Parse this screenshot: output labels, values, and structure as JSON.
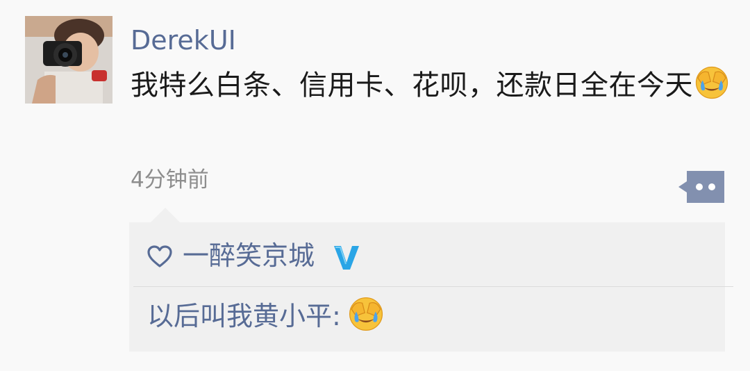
{
  "post": {
    "username": "DerekUI",
    "text": "我特么白条、信用卡、花呗，还款日全在今天",
    "emoji": "facepalm-laughing-emoji",
    "timestamp": "4分钟前"
  },
  "likes": {
    "names": "一醉笑京城",
    "icon": "heart-outline-icon",
    "badge_icon": "verified-v-icon"
  },
  "comment": {
    "author": "以后叫我黄小平",
    "separator": ":",
    "emoji": "facepalm-laughing-emoji"
  },
  "colors": {
    "link": "#576b95",
    "text": "#1a1a1a",
    "muted": "#8d8d8d",
    "panel": "#f0f0f0",
    "badge": "#2aa5e6"
  }
}
